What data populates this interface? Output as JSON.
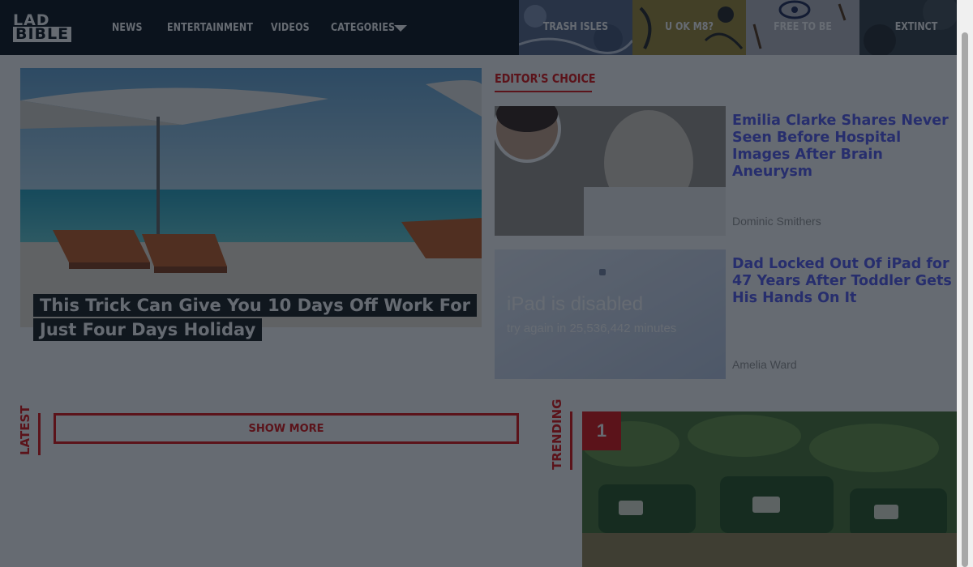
{
  "header": {
    "logo_line1": "LAD",
    "logo_line2": "BIBLE",
    "nav": [
      {
        "label": "NEWS"
      },
      {
        "label": "ENTERTAINMENT"
      },
      {
        "label": "VIDEOS"
      },
      {
        "label": "CATEGORIES"
      }
    ],
    "campaign_tiles": [
      {
        "label": "TRASH ISLES"
      },
      {
        "label": "U OK M8?"
      },
      {
        "label": "FREE TO BE"
      },
      {
        "label": "EXTINCT"
      }
    ]
  },
  "hero": {
    "title": "This Trick Can Give You 10 Days Off Work For Just Four Days Holiday"
  },
  "editors_choice": {
    "label": "EDITOR'S CHOICE",
    "articles": [
      {
        "headline": "Emilia Clarke Shares Never Seen Before Hospital Images After Brain Aneurysm",
        "author": "Dominic Smithers"
      },
      {
        "headline": "Dad Locked Out Of iPad for 47 Years After Toddler Gets His Hands On It",
        "author": "Amelia Ward",
        "image_text_1": "iPad is disabled",
        "image_text_2": "try again in 25,536,442 minutes"
      }
    ]
  },
  "latest": {
    "label": "LATEST",
    "show_more": "SHOW MORE"
  },
  "trending": {
    "label": "TRENDING",
    "rank": "1"
  },
  "colors": {
    "accent": "#e11a1a",
    "header_bg": "#101820",
    "headline_link": "#5a5ff2"
  }
}
